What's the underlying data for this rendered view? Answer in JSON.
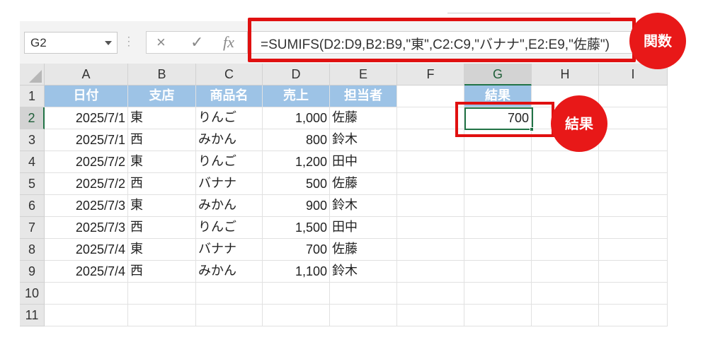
{
  "name_box": {
    "value": "G2"
  },
  "formula_bar": {
    "cancel_icon": "×",
    "enter_icon": "✓",
    "fx_label": "fx",
    "formula": "=SUMIFS(D2:D9,B2:B9,\"東\",C2:C9,\"バナナ\",E2:E9,\"佐藤\")"
  },
  "annotations": {
    "function_badge": "関数",
    "result_badge": "結果",
    "highlight_color": "#e01010"
  },
  "columns": [
    "A",
    "B",
    "C",
    "D",
    "E",
    "F",
    "G",
    "H",
    "I"
  ],
  "rows": [
    "1",
    "2",
    "3",
    "4",
    "5",
    "6",
    "7",
    "8",
    "9",
    "10",
    "11"
  ],
  "table": {
    "headers": [
      "日付",
      "支店",
      "商品名",
      "売上",
      "担当者"
    ],
    "rows": [
      [
        "2025/7/1",
        "東",
        "りんご",
        "1,000",
        "佐藤"
      ],
      [
        "2025/7/1",
        "西",
        "みかん",
        "800",
        "鈴木"
      ],
      [
        "2025/7/2",
        "東",
        "りんご",
        "1,200",
        "田中"
      ],
      [
        "2025/7/2",
        "西",
        "バナナ",
        "500",
        "佐藤"
      ],
      [
        "2025/7/3",
        "東",
        "みかん",
        "900",
        "鈴木"
      ],
      [
        "2025/7/3",
        "西",
        "りんご",
        "1,500",
        "田中"
      ],
      [
        "2025/7/4",
        "東",
        "バナナ",
        "700",
        "佐藤"
      ],
      [
        "2025/7/4",
        "西",
        "みかん",
        "1,100",
        "鈴木"
      ]
    ]
  },
  "result": {
    "header": "結果",
    "value": "700"
  },
  "colors": {
    "header_fill": "#9dc3e6",
    "excel_green": "#217346"
  }
}
